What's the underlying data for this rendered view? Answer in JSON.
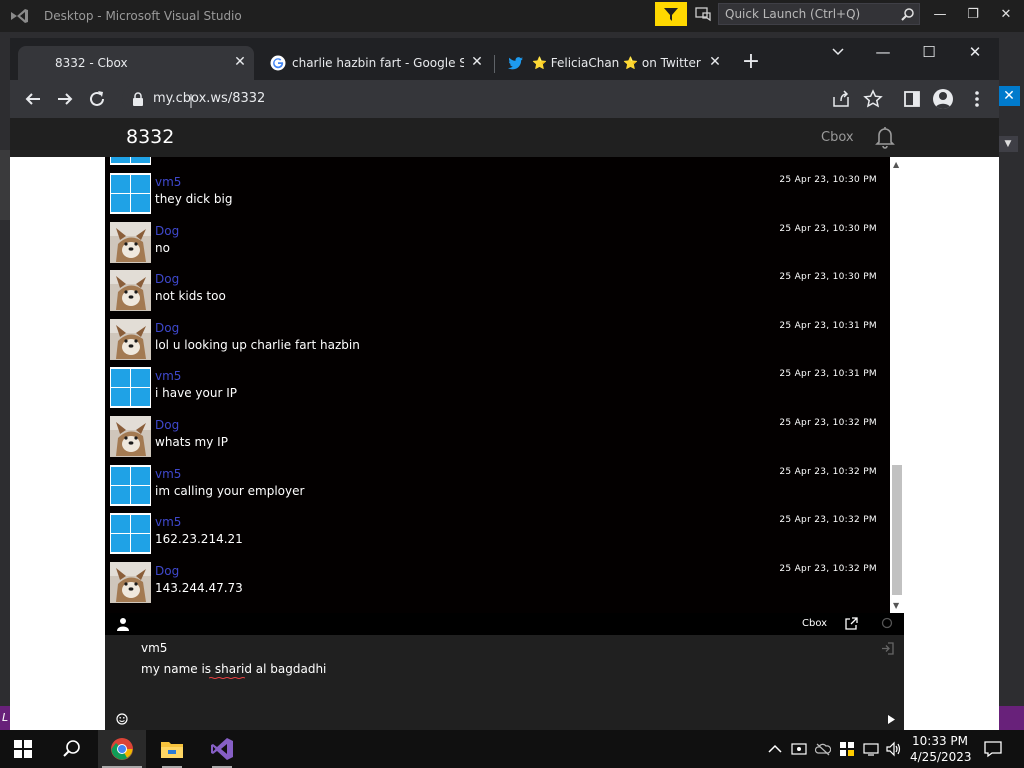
{
  "vs": {
    "title": "Desktop - Microsoft Visual Studio",
    "quick_launch_placeholder": "Quick Launch (Ctrl+Q)",
    "status_glyph": "L"
  },
  "browser": {
    "tabs": [
      {
        "title": "8332 - Cbox",
        "icon": "none",
        "active": true
      },
      {
        "title": "charlie hazbin fart - Google Search",
        "icon": "google-icon",
        "active": false
      },
      {
        "title": "⭐ FeliciaChan ⭐ on Twitter: \"@",
        "icon": "twitter-icon",
        "active": false
      }
    ],
    "url": "my.cbox.ws/8332"
  },
  "cbox": {
    "title": "8332",
    "brand": "Cbox",
    "bar_brand": "Cbox",
    "messages": [
      {
        "user": "vm5",
        "avatar": "windows-logo-avatar",
        "text": "they dick big",
        "time": "25 Apr 23, 10:30 PM"
      },
      {
        "user": "Dog",
        "avatar": "dog-avatar",
        "text": "no",
        "time": "25 Apr 23, 10:30 PM"
      },
      {
        "user": "Dog",
        "avatar": "dog-avatar",
        "text": "not kids too",
        "time": "25 Apr 23, 10:30 PM"
      },
      {
        "user": "Dog",
        "avatar": "dog-avatar",
        "text": "lol u looking up charlie fart hazbin",
        "time": "25 Apr 23, 10:31 PM"
      },
      {
        "user": "vm5",
        "avatar": "windows-logo-avatar",
        "text": "i have your IP",
        "time": "25 Apr 23, 10:31 PM"
      },
      {
        "user": "Dog",
        "avatar": "dog-avatar",
        "text": "whats my IP",
        "time": "25 Apr 23, 10:32 PM"
      },
      {
        "user": "vm5",
        "avatar": "windows-logo-avatar",
        "text": "im calling your employer",
        "time": "25 Apr 23, 10:32 PM"
      },
      {
        "user": "vm5",
        "avatar": "windows-logo-avatar",
        "text": "162.23.214.21",
        "time": "25 Apr 23, 10:32 PM"
      },
      {
        "user": "Dog",
        "avatar": "dog-avatar",
        "text": "143.244.47.73",
        "time": "25 Apr 23, 10:32 PM"
      }
    ],
    "compose": {
      "name": "vm5",
      "text": "my name is sharid al bagdadhi"
    }
  },
  "taskbar": {
    "time": "10:33 PM",
    "date": "4/25/2023"
  },
  "colors": {
    "chat_bg": "#030000",
    "username": "#3f48cc",
    "windows_blue": "#1fa2e6",
    "vs_purple": "#68217a"
  }
}
